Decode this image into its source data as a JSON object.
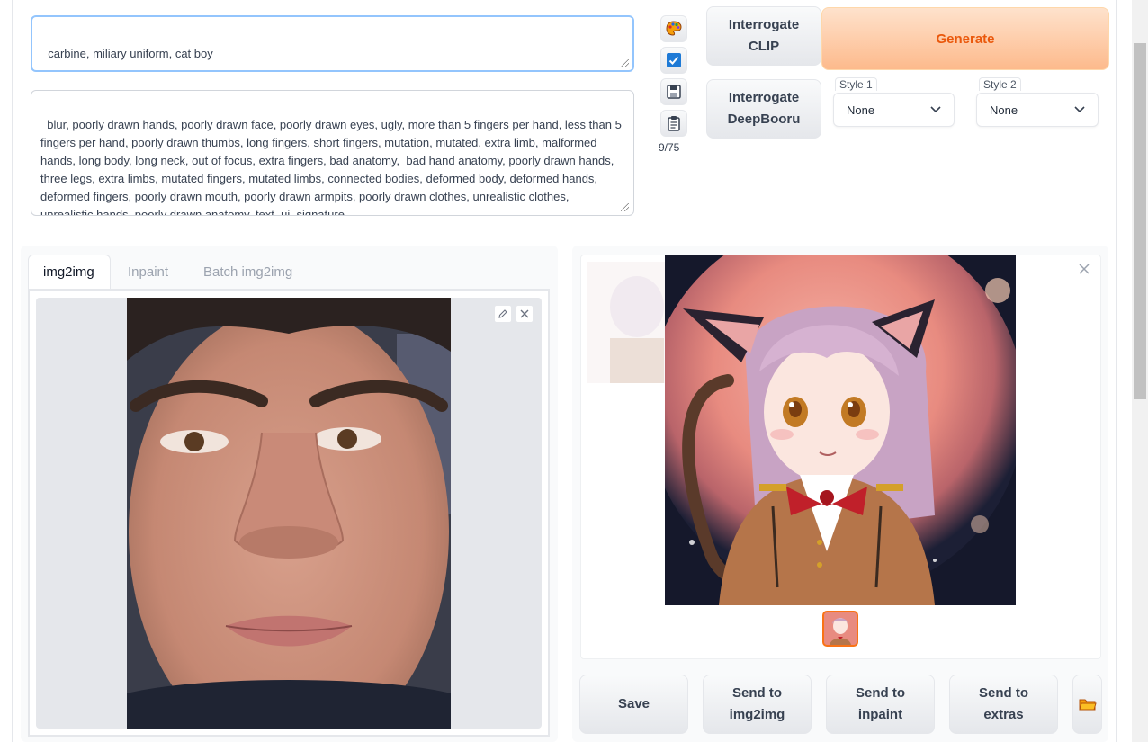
{
  "prompt": {
    "value": "carbine, miliary uniform, cat boy"
  },
  "negative_prompt": {
    "value": "blur, poorly drawn hands, poorly drawn face, poorly drawn eyes, ugly, more than 5 fingers per hand, less than 5 fingers per hand, poorly drawn thumbs, long fingers, short fingers, mutation, mutated, extra limb, malformed hands, long body, long neck, out of focus, extra fingers, bad anatomy,  bad hand anatomy, poorly drawn hands, three legs, extra limbs, mutated fingers, mutated limbs, connected bodies, deformed body, deformed hands, deformed fingers, poorly drawn mouth, poorly drawn armpits, poorly drawn clothes, unrealistic clothes, unrealistic hands, poorly drawn anatomy, text, ui, signature"
  },
  "token_counter": "9/75",
  "buttons": {
    "interrogate_clip": "Interrogate\nCLIP",
    "interrogate_deepbooru": "Interrogate\nDeepBooru",
    "generate": "Generate"
  },
  "styles": [
    {
      "label": "Style 1",
      "value": "None"
    },
    {
      "label": "Style 2",
      "value": "None"
    }
  ],
  "tabs": [
    "img2img",
    "Inpaint",
    "Batch img2img"
  ],
  "output_buttons": {
    "save": "Save",
    "send_img2img": "Send to\nimg2img",
    "send_inpaint": "Send to\ninpaint",
    "send_extras": "Send to\nextras"
  },
  "colors": {
    "accent": "#f97316",
    "generate_bg": "#fdba8c",
    "focus_border": "#93c5fd"
  },
  "icons": [
    "paint-palette-icon",
    "checkbox-icon",
    "save-disk-icon",
    "clipboard-icon",
    "pencil-icon",
    "close-icon",
    "folder-icon"
  ]
}
